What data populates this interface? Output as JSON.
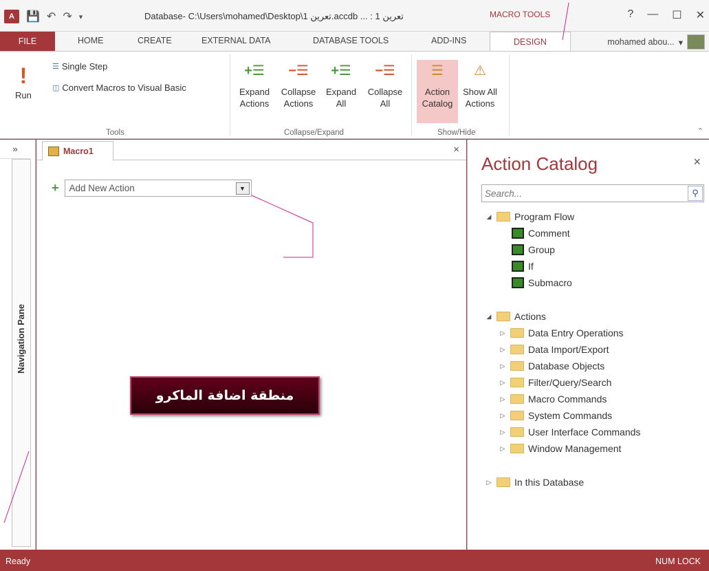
{
  "window": {
    "title": "Database- C:\\Users\\mohamed\\Desktop\\1 تعرين.accdb ... : تعرين 1",
    "context_tab": "MACRO TOOLS",
    "help": "?",
    "minimize": "—",
    "restore": "☐",
    "close": "✕",
    "app_icon": "A"
  },
  "tabs": [
    "FILE",
    "HOME",
    "CREATE",
    "EXTERNAL DATA",
    "DATABASE TOOLS",
    "ADD-INS",
    "DESIGN"
  ],
  "user": {
    "name": "mohamed abou...",
    "menu": "▾"
  },
  "ribbon": {
    "tools": {
      "run": "Run",
      "single_step": "Single Step",
      "convert": "Convert Macros to Visual Basic",
      "label": "Tools"
    },
    "collapse_expand": {
      "expand_actions": [
        "Expand",
        "Actions"
      ],
      "collapse_actions": [
        "Collapse",
        "Actions"
      ],
      "expand_all": [
        "Expand",
        "All"
      ],
      "collapse_all": [
        "Collapse",
        "All"
      ],
      "label": "Collapse/Expand"
    },
    "show_hide": {
      "action_catalog": [
        "Action",
        "Catalog"
      ],
      "show_all_actions": [
        "Show All",
        "Actions"
      ],
      "label": "Show/Hide"
    }
  },
  "nav_pane": {
    "label": "Navigation Pane",
    "chevron": "»"
  },
  "document": {
    "tab": "Macro1",
    "close": "×",
    "add_new_action_placeholder": "Add New Action",
    "callout": "منطقة اضافة الماكرو"
  },
  "catalog": {
    "title": "Action Catalog",
    "close": "×",
    "search_placeholder": "Search...",
    "program_flow": {
      "label": "Program Flow",
      "items": [
        "Comment",
        "Group",
        "If",
        "Submacro"
      ]
    },
    "actions": {
      "label": "Actions",
      "items": [
        "Data Entry Operations",
        "Data Import/Export",
        "Database Objects",
        "Filter/Query/Search",
        "Macro Commands",
        "System Commands",
        "User Interface Commands",
        "Window Management"
      ]
    },
    "in_this_database": "In this Database"
  },
  "status": {
    "left": "Ready",
    "right": "NUM LOCK"
  },
  "colors": {
    "accent": "#a4373a",
    "callout_bg": "#3a000e",
    "callout_border": "#c04070"
  }
}
